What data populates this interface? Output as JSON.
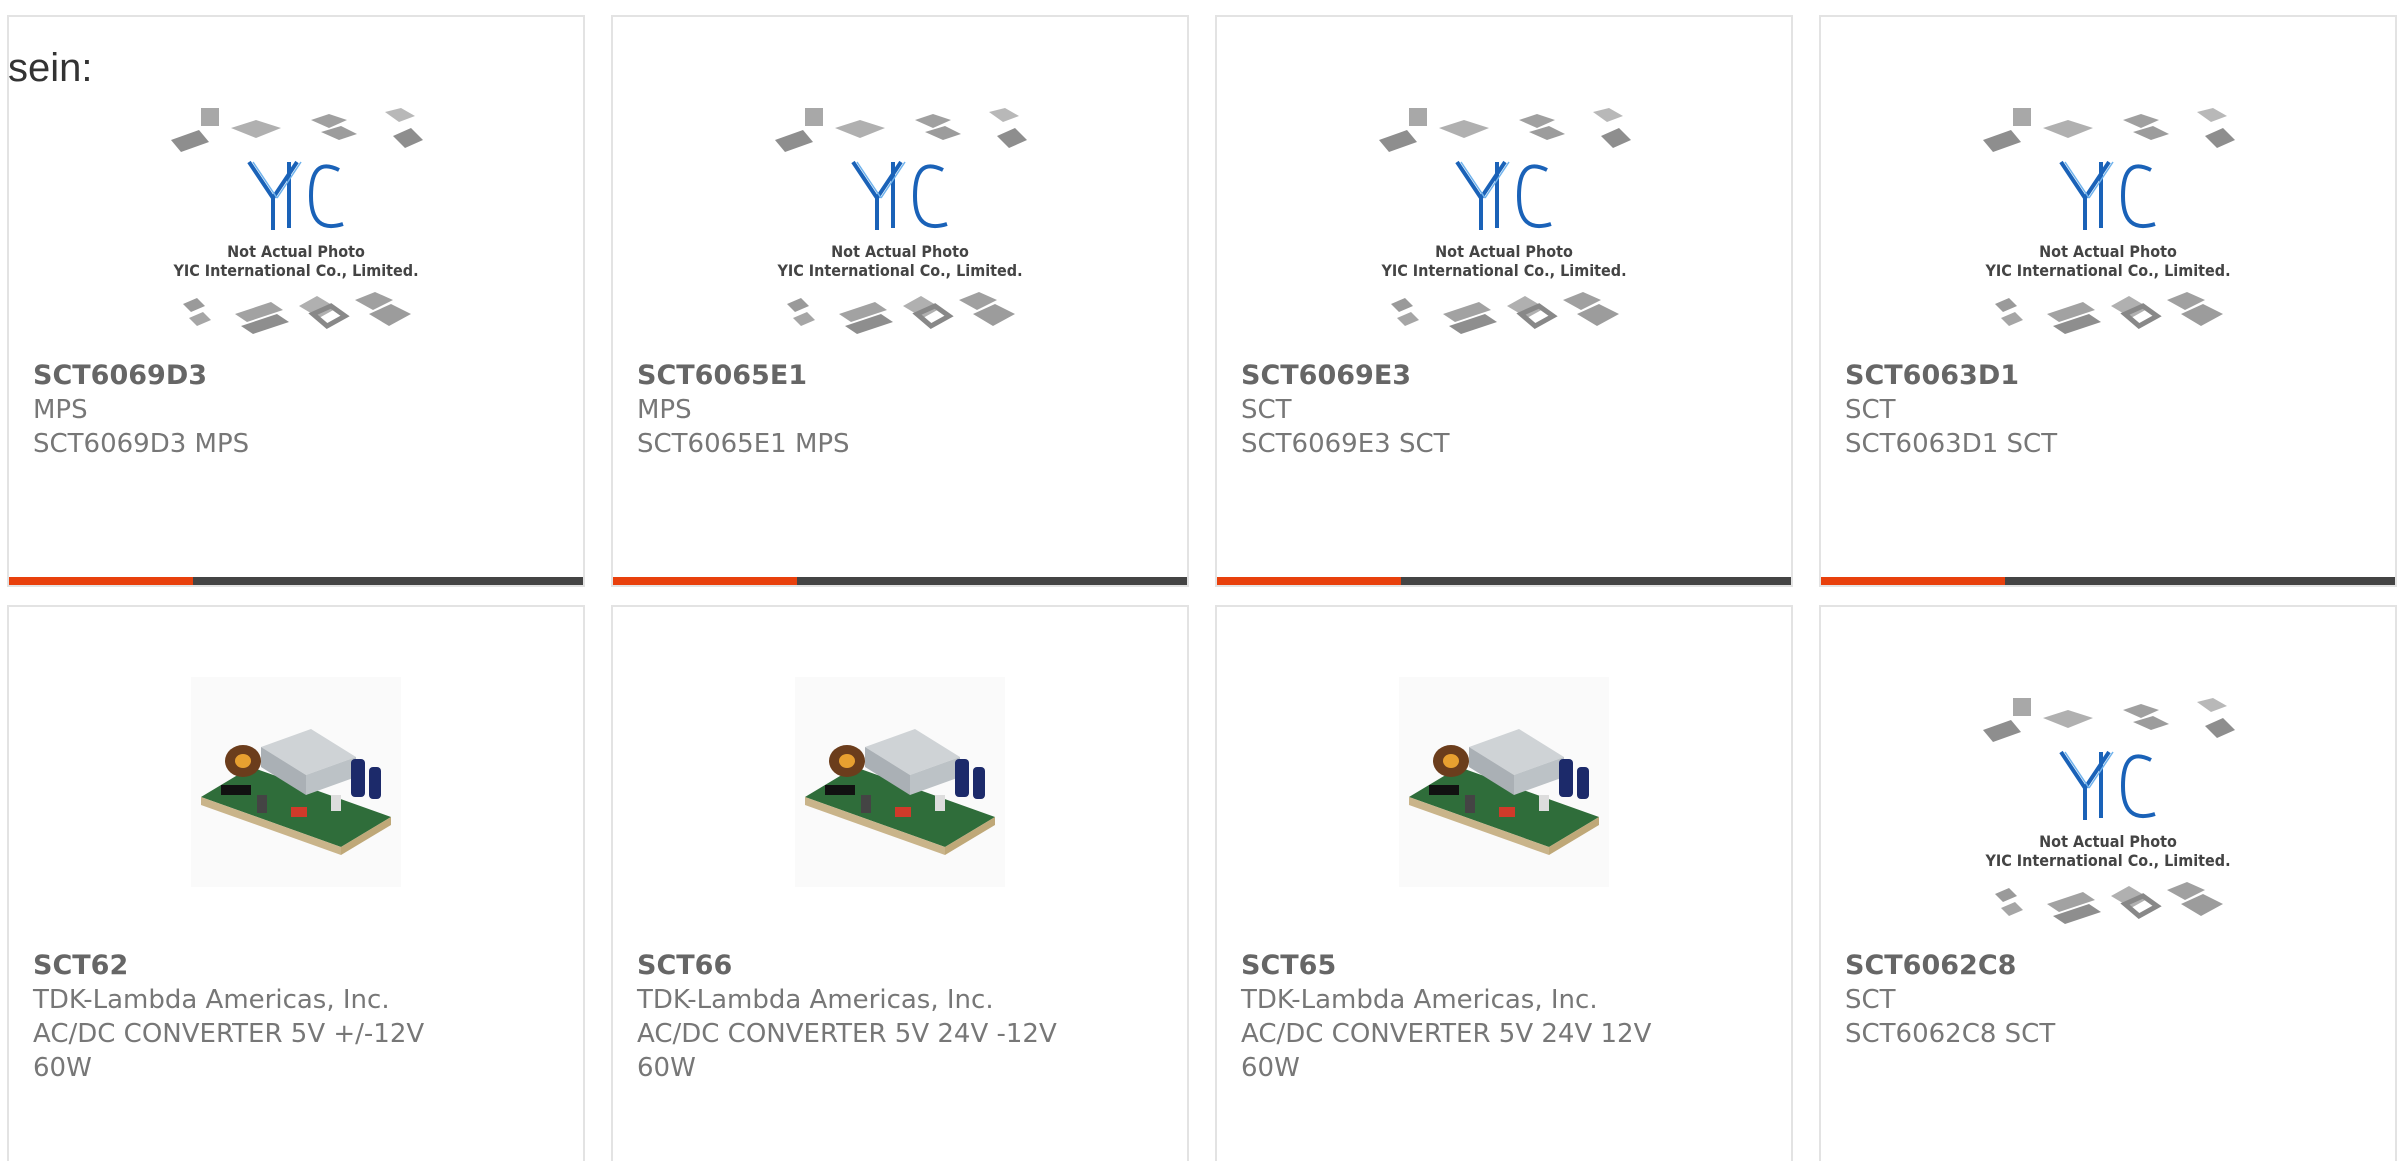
{
  "intro_text": "sein:",
  "colors": {
    "accent": "#e8400c",
    "bar_dark": "#444444",
    "logo_blue": "#1a62b8"
  },
  "placeholder_image": {
    "line1": "Not Actual Photo",
    "line2": "YIC International Co., Limited."
  },
  "products": [
    {
      "part": "SCT6069D3",
      "maker": "MPS",
      "desc1": "SCT6069D3 MPS",
      "desc2": "",
      "image": "placeholder"
    },
    {
      "part": "SCT6065E1",
      "maker": "MPS",
      "desc1": "SCT6065E1 MPS",
      "desc2": "",
      "image": "placeholder"
    },
    {
      "part": "SCT6069E3",
      "maker": "SCT",
      "desc1": "SCT6069E3 SCT",
      "desc2": "",
      "image": "placeholder"
    },
    {
      "part": "SCT6063D1",
      "maker": "SCT",
      "desc1": "SCT6063D1 SCT",
      "desc2": "",
      "image": "placeholder"
    },
    {
      "part": "SCT62",
      "maker": "TDK-Lambda Americas, Inc.",
      "desc1": "AC/DC CONVERTER 5V +/-12V",
      "desc2": "60W",
      "image": "power-supply"
    },
    {
      "part": "SCT66",
      "maker": "TDK-Lambda Americas, Inc.",
      "desc1": "AC/DC CONVERTER 5V 24V -12V",
      "desc2": "60W",
      "image": "power-supply"
    },
    {
      "part": "SCT65",
      "maker": "TDK-Lambda Americas, Inc.",
      "desc1": "AC/DC CONVERTER 5V 24V 12V",
      "desc2": "60W",
      "image": "power-supply"
    },
    {
      "part": "SCT6062C8",
      "maker": "SCT",
      "desc1": "SCT6062C8 SCT",
      "desc2": "",
      "image": "placeholder"
    }
  ]
}
